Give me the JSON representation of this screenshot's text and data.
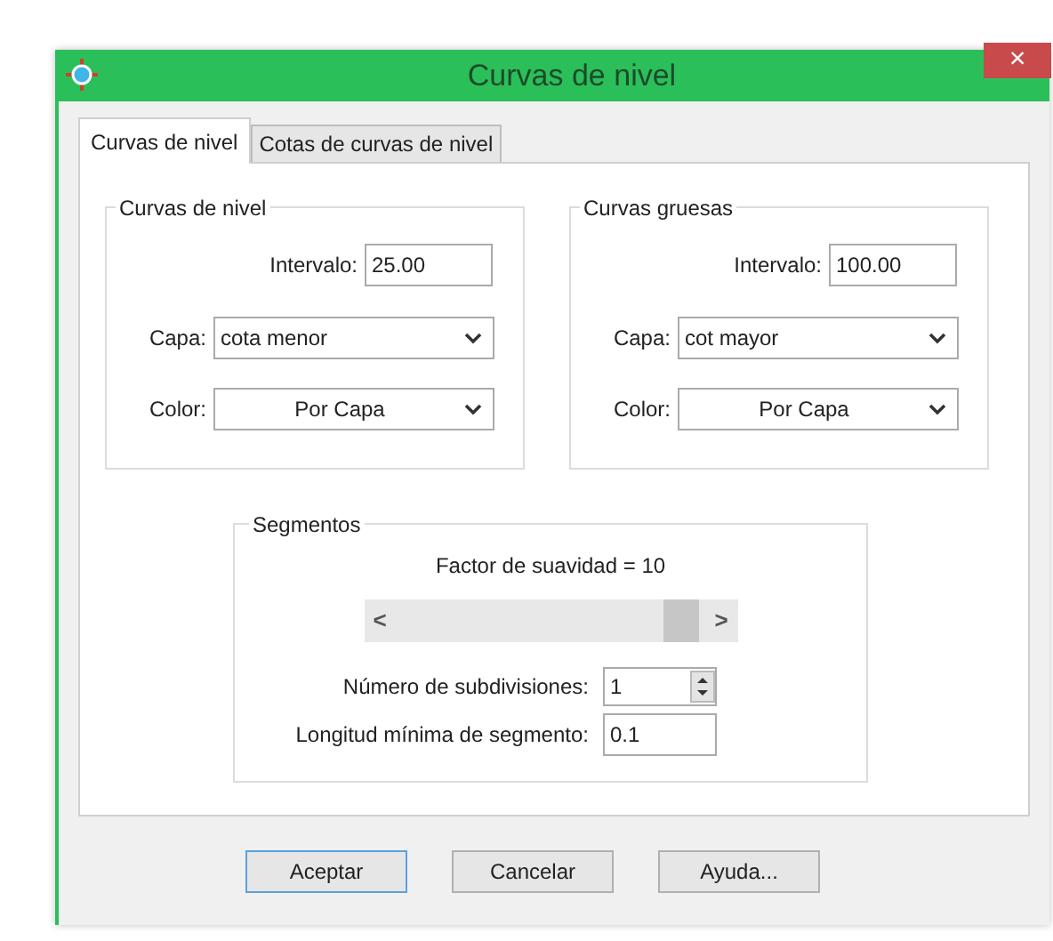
{
  "window": {
    "title": "Curvas de nivel",
    "close": "×"
  },
  "tabs": [
    {
      "label": "Curvas de nivel",
      "selected": true
    },
    {
      "label": "Cotas de curvas de nivel",
      "selected": false
    }
  ],
  "groups": [
    {
      "title": "Curvas de nivel",
      "interval": {
        "label": "Intervalo:",
        "value": "25.00"
      },
      "layer": {
        "label": "Capa:",
        "value": "cota menor"
      },
      "color": {
        "label": "Color:",
        "value": "Por Capa"
      }
    },
    {
      "title": "Curvas gruesas",
      "interval": {
        "label": "Intervalo:",
        "value": "100.00"
      },
      "layer": {
        "label": "Capa:",
        "value": "cot mayor"
      },
      "color": {
        "label": "Color:",
        "value": "Por Capa"
      }
    }
  ],
  "segments": {
    "title": "Segmentos",
    "smoothing_label": "Factor de suavidad = 10",
    "scroll_left": "<",
    "scroll_right": ">",
    "subdivisions": {
      "label": "Número de subdivisiones:",
      "value": "1"
    },
    "min_length": {
      "label": "Longitud mínima de segmento:",
      "value": "0.1"
    }
  },
  "buttons": [
    {
      "label": "Aceptar",
      "selected": true
    },
    {
      "label": "Cancelar",
      "selected": false
    },
    {
      "label": "Ayuda...",
      "selected": false
    }
  ]
}
